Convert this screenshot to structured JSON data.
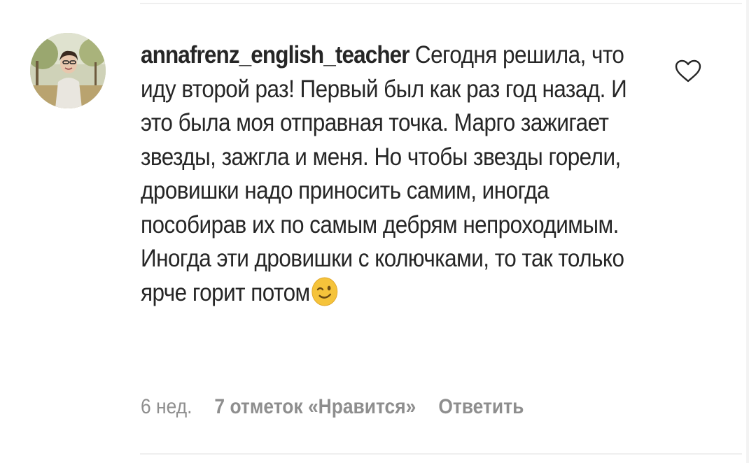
{
  "comment": {
    "username": "annafrenz_english_teacher",
    "text": "Сегодня решила, что иду второй раз! Первый был как раз год назад. И это была моя отправная точка. Марго зажигает звезды, зажгла и меня. Но чтобы звезды горели, дровишки надо приносить самим, иногда пособирав их по самым дебрям непроходимым. Иногда эти дровишки с колючками, то так только ярче горит потом",
    "emoji": "winking-face-emoji",
    "like_icon": "heart-outline-icon"
  },
  "meta": {
    "time_ago": "6 нед.",
    "likes_label": "7 отметок «Нравится»",
    "reply_label": "Ответить"
  },
  "colors": {
    "text": "#262626",
    "secondary": "#8e8e8e",
    "divider": "#efefef"
  }
}
